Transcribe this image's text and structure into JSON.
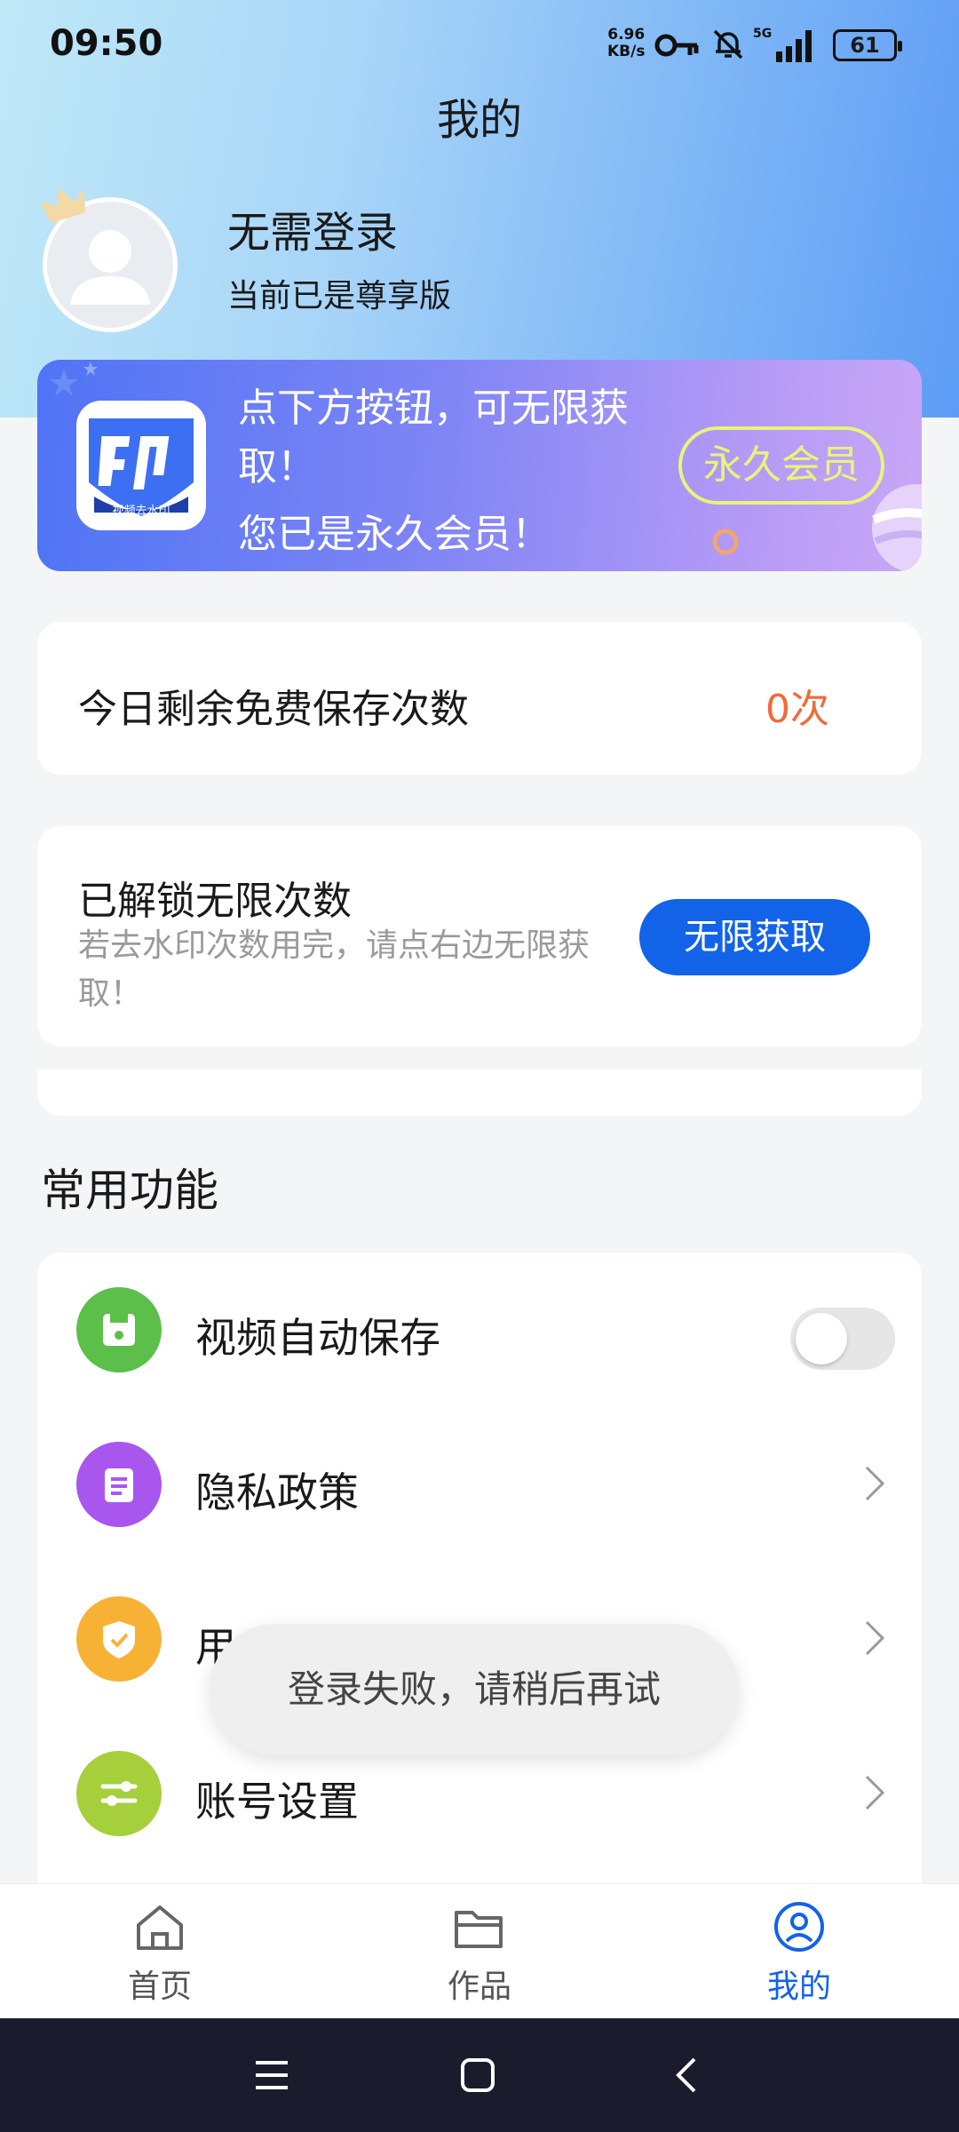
{
  "status_bar": {
    "time": "09:50",
    "net_rate_value": "6.96",
    "net_rate_unit": "KB/s",
    "network": "5G",
    "battery": "61"
  },
  "header": {
    "title": "我的"
  },
  "user": {
    "name": "无需登录",
    "subtitle": "当前已是尊享版"
  },
  "vip_banner": {
    "app_icon_text": "视频去水印",
    "line1": "点下方按钮，可无限获取！",
    "line2": "您已是永久会员！",
    "badge": "永久会员"
  },
  "free_saves": {
    "label": "今日剩余免费保存次数",
    "count": "0次"
  },
  "unlock": {
    "title": "已解锁无限次数",
    "description": "若去水印次数用完，请点右边无限获取！",
    "button": "无限获取"
  },
  "common_functions": {
    "title": "常用功能",
    "items": [
      {
        "label": "视频自动保存",
        "icon": "save-icon",
        "color": "#5cbf4a"
      },
      {
        "label": "隐私政策",
        "icon": "document-icon",
        "color": "#a956ef"
      },
      {
        "label": "用",
        "icon": "shield-icon",
        "color": "#f7b236"
      },
      {
        "label": "账号设置",
        "icon": "sliders-icon",
        "color": "#a6cf3c"
      }
    ]
  },
  "toast": {
    "message": "登录失败，请稍后再试"
  },
  "tabbar": {
    "tabs": [
      {
        "label": "首页",
        "icon": "home-icon"
      },
      {
        "label": "作品",
        "icon": "folder-icon"
      },
      {
        "label": "我的",
        "icon": "user-circle-icon"
      }
    ],
    "active_color": "#1363e8"
  }
}
